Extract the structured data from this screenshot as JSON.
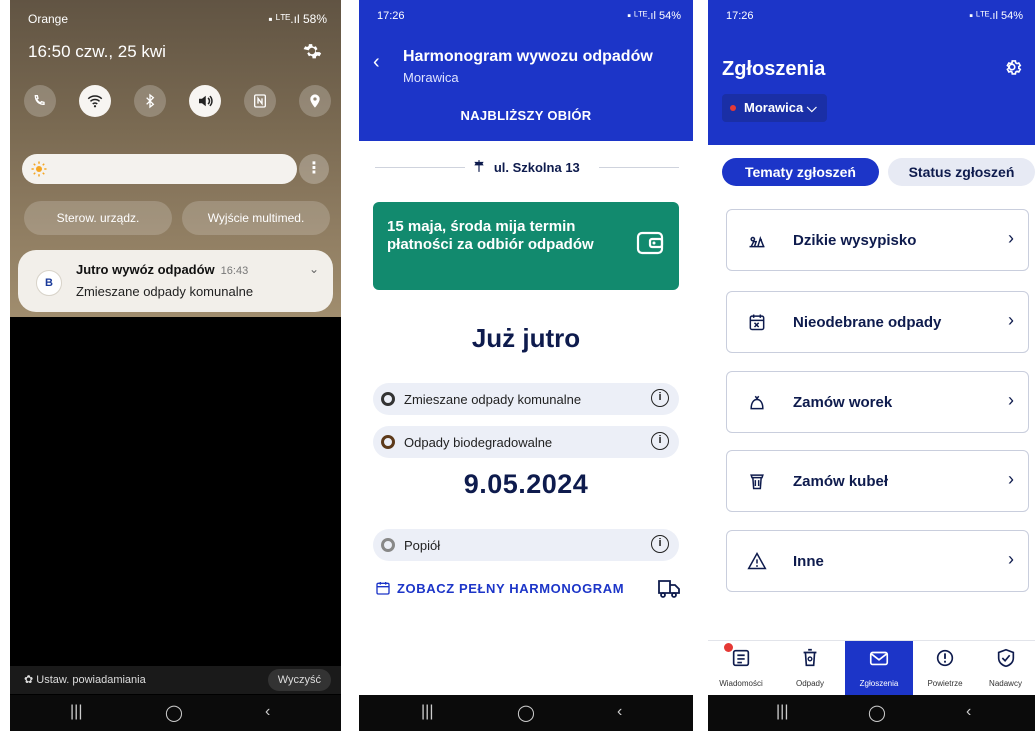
{
  "colors": {
    "brand_blue": "#1c35c8",
    "green_banner": "#128a6e",
    "navy_text": "#0e1b4d",
    "red_badge": "#e53935"
  },
  "phone1": {
    "carrier": "Orange",
    "status_right": "▪ ᴸᵀᴱ.ıl 58%",
    "datetime": "16:50  czw., 25 kwi",
    "quick_settings_icons": [
      "phone-wifi-icon",
      "wifi-icon",
      "bluetooth-icon",
      "sound-icon",
      "nfc-icon",
      "location-icon"
    ],
    "device_control": "Sterow. urządz.",
    "media_output": "Wyjście multimed.",
    "notification": {
      "app_icon_letter": "B",
      "title": "Jutro wywóz odpadów",
      "time": "16:43",
      "body": "Zmieszane odpady komunalne"
    },
    "notification_settings": "Ustaw. powiadamiania",
    "clear": "Wyczyść"
  },
  "phone2": {
    "status_time": "17:26",
    "status_right": "▪ ᴸᵀᴱ.ıl 54%",
    "title": "Harmonogram wywozu odpadów",
    "subtitle": "Morawica",
    "tab": "NAJBLIŻSZY OBIÓR",
    "address": "ul. Szkolna 13",
    "banner": "15 maja, środa mija termin płatności za odbiór odpadów",
    "heading": "Już jutro",
    "tomorrow": [
      {
        "label": "Zmieszane odpady komunalne",
        "dot": "#333333"
      },
      {
        "label": "Odpady biodegradowalne",
        "dot": "#5d3a1a"
      }
    ],
    "date": "9.05.2024",
    "later": [
      {
        "label": "Popiół",
        "dot": "#888888"
      }
    ],
    "full_schedule": "ZOBACZ PEŁNY HARMONOGRAM"
  },
  "phone3": {
    "status_time": "17:26",
    "status_right": "▪ ᴸᵀᴱ.ıl 54%",
    "title": "Zgłoszenia",
    "location": "Morawica",
    "segments": [
      "Tematy zgłoszeń",
      "Status zgłoszeń"
    ],
    "items": [
      {
        "label": "Dzikie wysypisko",
        "icon": "dump-icon"
      },
      {
        "label": "Nieodebrane odpady",
        "icon": "calendar-x-icon"
      },
      {
        "label": "Zamów worek",
        "icon": "bag-icon"
      },
      {
        "label": "Zamów kubeł",
        "icon": "bin-icon"
      },
      {
        "label": "Inne",
        "icon": "warning-icon"
      }
    ],
    "tabs": [
      {
        "label": "Wiadomości",
        "icon": "news-icon"
      },
      {
        "label": "Odpady",
        "icon": "trash-icon"
      },
      {
        "label": "Zgłoszenia",
        "icon": "mail-icon"
      },
      {
        "label": "Powietrze",
        "icon": "alert-cloud-icon"
      },
      {
        "label": "Nadawcy",
        "icon": "shield-icon"
      }
    ]
  }
}
